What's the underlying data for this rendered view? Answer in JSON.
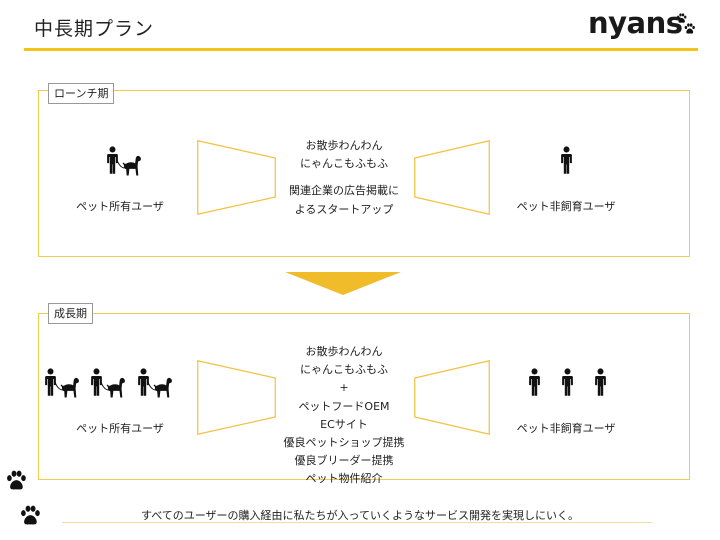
{
  "header": {
    "title": "中長期プラン",
    "logo_text": "nyans"
  },
  "launch": {
    "label": "ローンチ期",
    "left_label": "ペット所有ユーザ",
    "right_label": "ペット非飼育ユーザ",
    "center": [
      "お散歩わんわん",
      "にゃんこもふもふ",
      "関連企業の広告掲載に",
      "よるスタートアップ"
    ]
  },
  "growth": {
    "label": "成長期",
    "left_label": "ペット所有ユーザ",
    "right_label": "ペット非飼育ユーザ",
    "center": [
      "お散歩わんわん",
      "にゃんこもふもふ",
      "+",
      "ペットフードOEM",
      "ECサイト",
      "優良ペットショップ提携",
      "優良ブリーダー提携",
      "ペット物件紹介"
    ]
  },
  "footer": {
    "text": "すべてのユーザーの購入経由に私たちが入っていくようなサービス開発を実現しにいく。"
  },
  "colors": {
    "accent": "#f3c31a",
    "frame": "#f6c94f"
  },
  "icons": [
    "person-with-dog-icon",
    "person-icon",
    "paw-icon"
  ]
}
